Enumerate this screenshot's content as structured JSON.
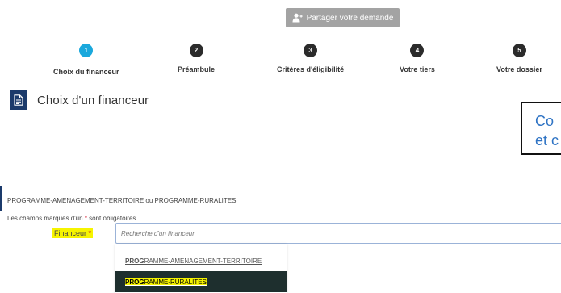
{
  "share": {
    "label": "Partager votre demande"
  },
  "steps": [
    {
      "number": "1",
      "label": "Choix du financeur",
      "active": true
    },
    {
      "number": "2",
      "label": "Préambule",
      "active": false
    },
    {
      "number": "3",
      "label": "Critères d'éligibilité",
      "active": false
    },
    {
      "number": "4",
      "label": "Votre tiers",
      "active": false
    },
    {
      "number": "5",
      "label": "Votre dossier",
      "active": false
    }
  ],
  "section": {
    "title": "Choix d'un financeur"
  },
  "callout": {
    "line1": "Co",
    "line2": "et c"
  },
  "info": {
    "programs": "PROGRAMME-AMENAGEMENT-TERRITOIRE ou PROGRAMME-RURALITES",
    "required_prefix": "Les champs marqués d'un ",
    "required_star": "*",
    "required_suffix": " sont obligatoires."
  },
  "financeur": {
    "label": "Financeur",
    "star": "*",
    "placeholder": "Recherche d'un financeur"
  },
  "dropdown": {
    "typed": "PROG",
    "options": [
      {
        "match": "PROG",
        "rest": "RAMME-AMENAGEMENT-TERRITOIRE"
      },
      {
        "match": "PROG",
        "rest": "RAMME-RURALITES"
      }
    ]
  },
  "colors": {
    "active_step": "#1aa8dc",
    "step": "#2b2b2b",
    "primary": "#1b3a6b",
    "highlight": "#f6f400",
    "selected_option_bg": "#1e2f2e",
    "required": "#d0021b",
    "callout_text": "#2e73c4"
  }
}
